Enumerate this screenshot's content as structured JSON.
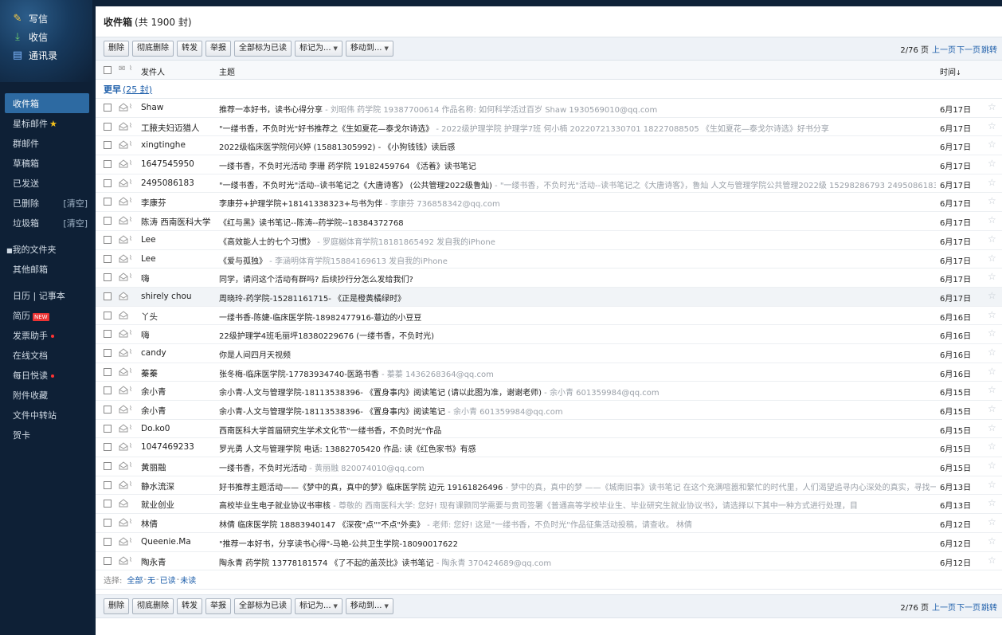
{
  "sidebar": {
    "compose": [
      {
        "label": "写信",
        "icon": "pencil-icon"
      },
      {
        "label": "收信",
        "icon": "inbox-download-icon"
      },
      {
        "label": "通讯录",
        "icon": "address-book-icon"
      }
    ],
    "folders1": [
      {
        "label": "收件箱",
        "active": true
      },
      {
        "label": "星标邮件"
      },
      {
        "label": "群邮件"
      },
      {
        "label": "草稿箱"
      },
      {
        "label": "已发送"
      },
      {
        "label": "已删除",
        "clear": "[清空]"
      },
      {
        "label": "垃圾箱",
        "clear": "[清空]"
      }
    ],
    "folders2": [
      {
        "label": "我的文件夹"
      },
      {
        "label": "其他邮箱"
      }
    ],
    "folders3": [
      {
        "label": "日历 | 记事本"
      },
      {
        "label": "简历"
      },
      {
        "label": "发票助手"
      },
      {
        "label": "在线文档"
      },
      {
        "label": "每日悦读"
      },
      {
        "label": "附件收藏"
      },
      {
        "label": "文件中转站"
      },
      {
        "label": "贺卡"
      }
    ],
    "new_badge": "NEW"
  },
  "header": {
    "title": "收件箱",
    "count": "(共 1900 封)"
  },
  "toolbar": {
    "delete": "删除",
    "delete_forever": "彻底删除",
    "forward": "转发",
    "report": "举报",
    "mark_all_read": "全部标为已读",
    "mark_as": "标记为...",
    "move_to": "移动到...",
    "page_info": "2/76 页",
    "prev_page": "上一页",
    "next_page": "下一页",
    "jump": "跳转"
  },
  "columns": {
    "sender": "发件人",
    "subject": "主题",
    "time": "时间"
  },
  "group": {
    "label": "更早",
    "count": "(25 封)"
  },
  "emails": [
    {
      "sender": "Shaw",
      "subject": "推荐一本好书，读书心得分享",
      "preview": " - 刘昭伟 药学院 19387700614 作品名称: 如何科学活过百岁  Shaw 1930569010@qq.com",
      "date": "6月17日",
      "attach": true
    },
    {
      "sender": "工腋夫妇迈猎人",
      "subject": "\"一缕书香，不负时光\"好书推荐之《生如夏花—泰戈尔诗选》",
      "preview": " - 2022级护理学院 护理学7班 何小楠  20220721330701 18227088505 《生如夏花—泰戈尔诗选》好书分享",
      "date": "6月17日",
      "attach": true
    },
    {
      "sender": "xingtinghe",
      "subject": "2022级临床医学院何兴婷 (15881305992) - 《小狗钱钱》读后感",
      "preview": "",
      "date": "6月17日",
      "attach": true
    },
    {
      "sender": "1647545950",
      "subject": "一缕书香，不负时光活动 李珊 药学院 19182459764 《活着》读书笔记",
      "preview": "",
      "date": "6月17日",
      "attach": true
    },
    {
      "sender": "2495086183",
      "subject": "\"一缕书香，不负时光\"活动--读书笔记之《大唐诗客》 (公共管理2022级鲁灿)",
      "preview": " - \"一缕书香，不负时光\"活动--读书笔记之《大唐诗客》，鲁灿 人文与管理学院公共管理2022级 15298286793  2495086183 2495086183@qq.com",
      "date": "6月17日",
      "attach": true
    },
    {
      "sender": "李康芬",
      "subject": "李康芬+护理学院+18141338323+与书为伴",
      "preview": " - 李康芬 736858342@qq.com",
      "date": "6月17日",
      "attach": true
    },
    {
      "sender": "陈涛 西南医科大学",
      "subject": "《红与黑》读书笔记--陈涛--药学院--18384372768",
      "preview": "",
      "date": "6月17日",
      "attach": true
    },
    {
      "sender": "Lee",
      "subject": "《高效能人士的七个习惯》",
      "preview": " - 罗庭樾体育学院18181865492 发自我的iPhone",
      "date": "6月17日",
      "attach": true
    },
    {
      "sender": "Lee",
      "subject": "《爱与孤独》",
      "preview": " - 李涵明体育学院15884169613 发自我的iPhone",
      "date": "6月17日",
      "attach": true
    },
    {
      "sender": "嗨",
      "subject": "同学，请问这个活动有群吗? 后续抄行分怎么发给我们?",
      "preview": "",
      "date": "6月17日",
      "attach": true
    },
    {
      "sender": "shirely chou",
      "subject": "周晓玲-药学院-15281161715- 《正是橙黄橘绿时》",
      "preview": "",
      "date": "6月17日",
      "attach": false,
      "hl": true
    },
    {
      "sender": "丫头",
      "subject": "一缕书香-陈婕-临床医学院-18982477916-薏边的小豆豆",
      "preview": "",
      "date": "6月16日",
      "attach": false
    },
    {
      "sender": "嗨",
      "subject": "22级护理学4班毛丽坪18380229676 (一缕书香，不负时光)",
      "preview": "",
      "date": "6月16日",
      "attach": true
    },
    {
      "sender": "candy",
      "subject": "你是人间四月天视频",
      "preview": "",
      "date": "6月16日",
      "attach": true
    },
    {
      "sender": "蓁蓁",
      "subject": "张冬梅-临床医学院-17783934740-医路书香",
      "preview": " - 蓁蓁 1436268364@qq.com",
      "date": "6月16日",
      "attach": true
    },
    {
      "sender": "余小青",
      "subject": "余小青-人文与管理学院-18113538396- 《置身事内》阅读笔记 (请以此图为准，谢谢老师)",
      "preview": " - 余小青 601359984@qq.com",
      "date": "6月15日",
      "attach": true
    },
    {
      "sender": "余小青",
      "subject": "余小青-人文与管理学院-18113538396- 《置身事内》阅读笔记",
      "preview": " - 余小青 601359984@qq.com",
      "date": "6月15日",
      "attach": true
    },
    {
      "sender": "Do.ko0",
      "subject": "西南医科大学首届研究生学术文化节\"一缕书香，不负时光\"作品",
      "preview": "",
      "date": "6月15日",
      "attach": true
    },
    {
      "sender": "1047469233",
      "subject": "罗光勇 人文与管理学院 电话: 13882705420 作品: 读《红色家书》有感",
      "preview": "",
      "date": "6月15日",
      "attach": true
    },
    {
      "sender": "黄丽融",
      "subject": "一缕书香，不负时光活动",
      "preview": " - 黄丽融 820074010@qq.com",
      "date": "6月15日",
      "attach": true
    },
    {
      "sender": "静水流深",
      "subject": "好书推荐主题活动——《梦中的真，真中的梦》临床医学院 边元 19161826496",
      "preview": " - 梦中的真，真中的梦  ——《城南旧事》读书笔记  在这个充满喧嚣和繁忙的时代里，人们渴望追寻内心深处的真实，寻找一个更宽阔、更恒久的世界。",
      "date": "6月13日",
      "attach": true
    },
    {
      "sender": "就业创业",
      "subject": "高校毕业生电子就业协议书审核",
      "preview": " - 尊敬的 西南医科大学:   您好! 现有课颢同学需要与贵司签署《普通高等学校毕业生、毕业研究生就业协议书》，请选择以下其中一种方式进行处理，目",
      "date": "6月13日",
      "attach": false
    },
    {
      "sender": "林倩",
      "subject": "林倩 临床医学院 18883940147 《深夜\"点\"\"不点\"外卖》",
      "preview": " - 老师:      您好!      这是\"一缕书香，不负时光\"作品征集活动投稿，请查收。                                                        林倩",
      "date": "6月12日",
      "attach": true
    },
    {
      "sender": "Queenie.Ma",
      "subject": "\"推荐一本好书，分享读书心得\"-马艳-公共卫生学院-18090017622",
      "preview": "",
      "date": "6月12日",
      "attach": true
    },
    {
      "sender": "陶永青",
      "subject": "陶永青 药学院 13778181574 《了不起的盖茨比》读书笔记",
      "preview": " - 陶永青 370424689@qq.com",
      "date": "6月12日",
      "attach": true
    }
  ],
  "select_bar": {
    "label": "选择:",
    "all": "全部",
    "none": "无",
    "read": "已读",
    "unread": "未读"
  }
}
